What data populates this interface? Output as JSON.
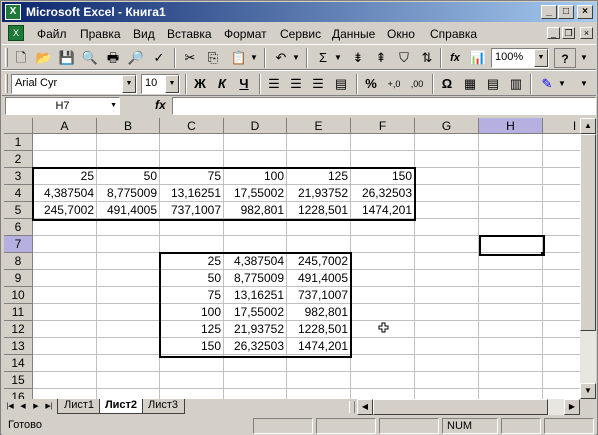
{
  "window": {
    "title": "Microsoft Excel - Книга1",
    "min": "_",
    "max": "□",
    "close": "×"
  },
  "menu": [
    "Файл",
    "Правка",
    "Вид",
    "Вставка",
    "Формат",
    "Сервис",
    "Данные",
    "Окно",
    "Справка"
  ],
  "toolbar": {
    "zoom": "100%",
    "font": "Arial Cyr",
    "size": "10",
    "bold": "Ж",
    "italic": "К",
    "underline": "Ч",
    "percent": "%",
    "inc_decimal": "+,0",
    "dec_decimal": ",00",
    "symbol": "Ω",
    "sigma": "Σ",
    "fx": "fx",
    "help": "?"
  },
  "formula_bar": {
    "name_box": "H7",
    "fx": "fx",
    "content": ""
  },
  "columns": [
    "A",
    "B",
    "C",
    "D",
    "E",
    "F",
    "G",
    "H",
    "I"
  ],
  "rows": [
    "1",
    "2",
    "3",
    "4",
    "5",
    "6",
    "7",
    "8",
    "9",
    "10",
    "11",
    "12",
    "13",
    "14",
    "15",
    "16"
  ],
  "cells": {
    "row3": [
      "25",
      "50",
      "75",
      "100",
      "125",
      "150"
    ],
    "row4": [
      "4,387504",
      "8,775009",
      "13,16251",
      "17,55002",
      "21,93752",
      "26,32503"
    ],
    "row5": [
      "245,7002",
      "491,4005",
      "737,1007",
      "982,801",
      "1228,501",
      "1474,201"
    ],
    "table2": [
      [
        "25",
        "4,387504",
        "245,7002"
      ],
      [
        "50",
        "8,775009",
        "491,4005"
      ],
      [
        "75",
        "13,16251",
        "737,1007"
      ],
      [
        "100",
        "17,55002",
        "982,801"
      ],
      [
        "125",
        "21,93752",
        "1228,501"
      ],
      [
        "150",
        "26,32503",
        "1474,201"
      ]
    ]
  },
  "sheets": [
    "Лист1",
    "Лист2",
    "Лист3"
  ],
  "active_sheet": "Лист2",
  "status": {
    "ready": "Готово",
    "num": "NUM"
  }
}
